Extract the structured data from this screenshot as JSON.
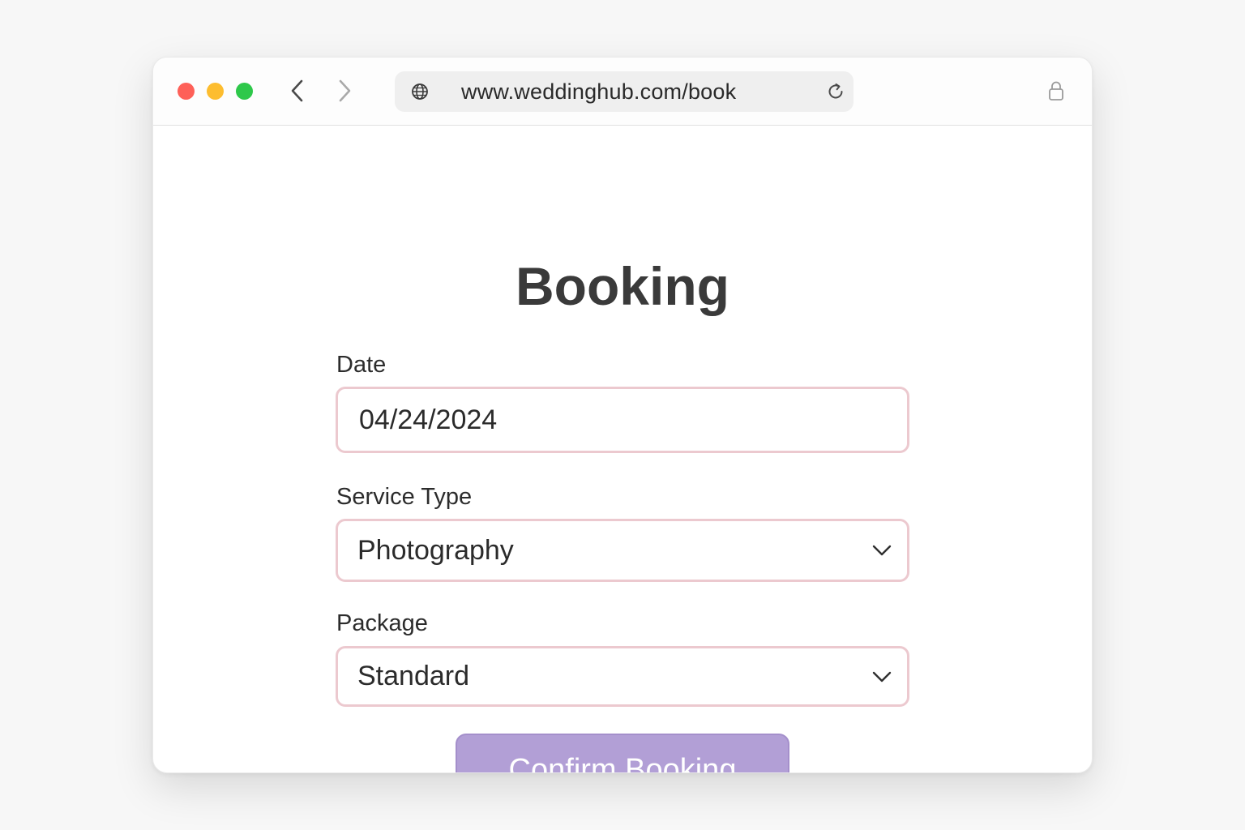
{
  "browser": {
    "url": "www.weddinghub.com/book",
    "traffic_lights": {
      "close_color": "#fe6058",
      "minimize_color": "#fdbd2f",
      "maximize_color": "#2ec84a"
    },
    "icons": {
      "back": "chevron-left-icon",
      "forward": "chevron-right-icon",
      "site": "globe-icon",
      "reload": "reload-icon",
      "lock": "lock-icon"
    }
  },
  "page": {
    "title": "Booking",
    "form": {
      "date": {
        "label": "Date",
        "value": "04/24/2024"
      },
      "service_type": {
        "label": "Service Type",
        "selected": "Photography"
      },
      "package": {
        "label": "Package",
        "selected": "Standard"
      },
      "confirm_label": "Confirm Booking"
    }
  },
  "colors": {
    "field_border": "#ecc9cf",
    "button_background": "#b29fd6",
    "title_text": "#3a3a3a"
  }
}
